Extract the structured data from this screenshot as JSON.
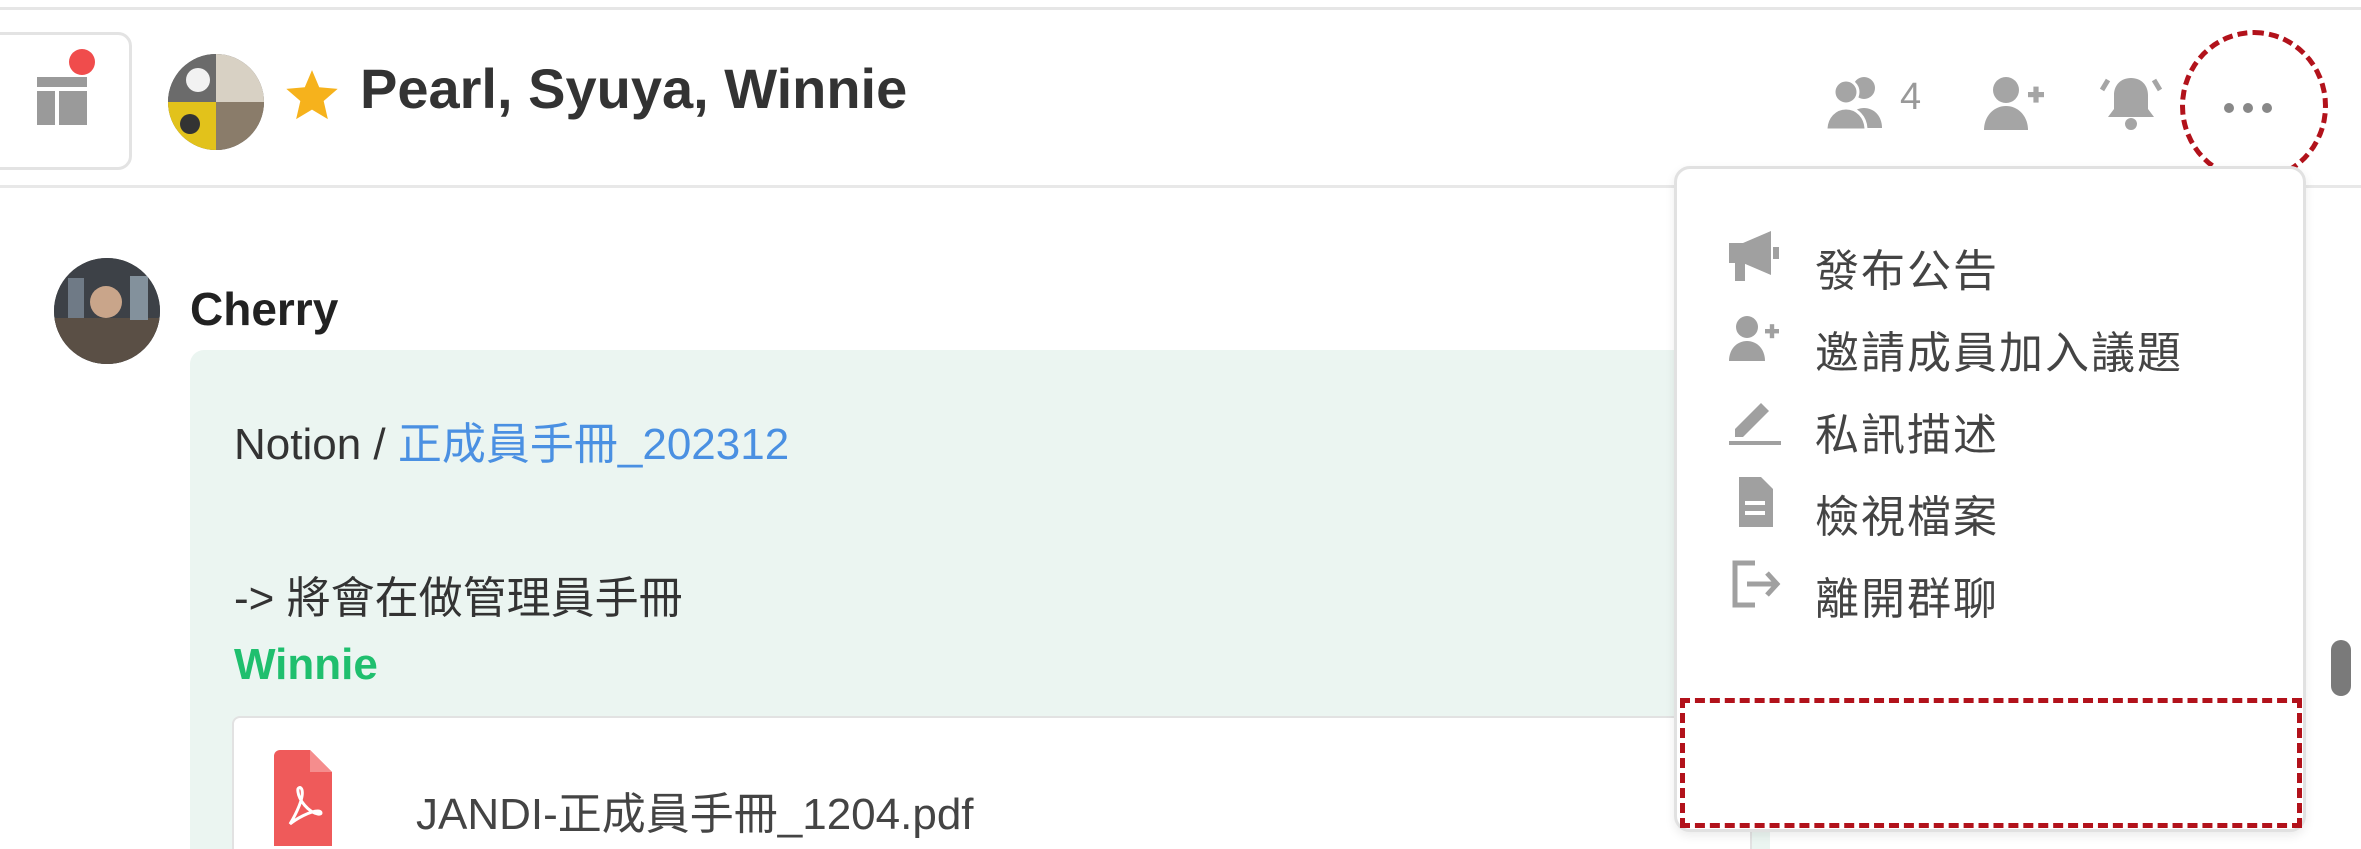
{
  "header": {
    "room_title": "Pearl, Syuya, Winnie",
    "member_count": "4",
    "icons": [
      "layout-icon",
      "star-icon",
      "members-icon",
      "add-member-icon",
      "notification-bell-icon",
      "more-icon"
    ]
  },
  "message": {
    "author": "Cherry",
    "line1_prefix": "Notion / ",
    "line1_link": "正成員手冊_202312",
    "line2": "-> 將會在做管理員手冊",
    "mention": "Winnie",
    "attachment": {
      "file_name": "JANDI-正成員手冊_1204.pdf",
      "icon": "pdf-icon"
    }
  },
  "menu": {
    "items": [
      {
        "label": "發布公告",
        "icon": "megaphone-icon"
      },
      {
        "label": "邀請成員加入議題",
        "icon": "add-member-icon"
      },
      {
        "label": "私訊描述",
        "icon": "pencil-icon"
      },
      {
        "label": "檢視檔案",
        "icon": "file-icon"
      },
      {
        "label": "離開群聊",
        "icon": "exit-icon"
      }
    ]
  },
  "colors": {
    "highlight": "#b2121b",
    "link": "#4a90e2",
    "mention": "#1fbf6e",
    "bubble": "#ebf5f1",
    "star": "#f6b21c",
    "notification": "#f04c4c"
  }
}
